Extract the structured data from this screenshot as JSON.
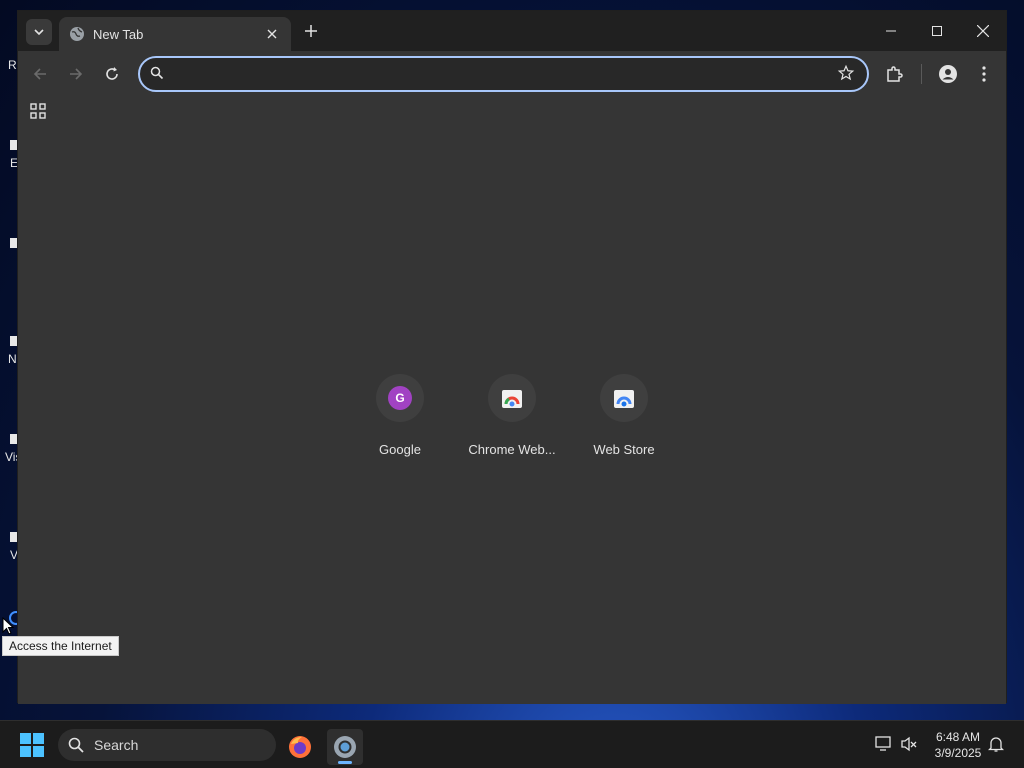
{
  "desktop": {
    "partial_labels": [
      "R",
      "E",
      "N",
      "Vis",
      "V"
    ]
  },
  "browser": {
    "tab_title": "New Tab",
    "omnibox": {
      "value": "",
      "placeholder": ""
    },
    "shortcuts": [
      {
        "label": "Google",
        "icon": "google-favicon"
      },
      {
        "label": "Chrome Web...",
        "icon": "chrome-web-store-favicon"
      },
      {
        "label": "Web Store",
        "icon": "web-store-favicon"
      }
    ]
  },
  "tooltip": {
    "text": "Access the Internet"
  },
  "taskbar": {
    "search_label": "Search",
    "time": "6:48 AM",
    "date": "3/9/2025"
  },
  "colors": {
    "omnibox_focus": "#a8c7fa",
    "window_bg": "#353535",
    "titlebar_bg": "#202020",
    "google_badge": "#a142c3"
  }
}
